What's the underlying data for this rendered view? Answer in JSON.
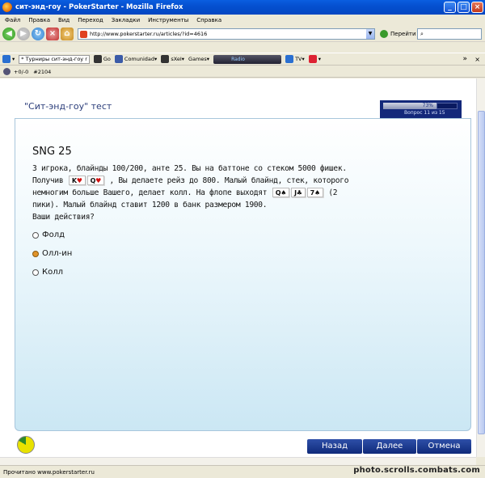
{
  "window": {
    "title": "сит-энд-гоу - PokerStarter - Mozilla Firefox"
  },
  "menu": {
    "items": [
      "Файл",
      "Правка",
      "Вид",
      "Переход",
      "Закладки",
      "Инструменты",
      "Справка"
    ]
  },
  "nav": {
    "url": "http://www.pokerstarter.ru/articles/?id=4616",
    "go_label": "Перейти",
    "search_placeholder": ""
  },
  "bookmarks": {
    "tournaments": "* Турниры сит-энд-гоу r",
    "go": "Go",
    "comunidad": "Comunidad",
    "sxel": "sXeI",
    "games": "Games",
    "radio": "Radio",
    "tv": "TV"
  },
  "subbar": {
    "counter": "+0/-0",
    "id": "#2104"
  },
  "quiz": {
    "title": "\"Сит-энд-гоу\" тест",
    "progress_pct": "73%",
    "progress_value": 0.73,
    "progress_label": "Вопрос 11 из 15",
    "question_title": "SNG 25",
    "text_1": "3 игрока, блайнды 100/200, анте 25. Вы на баттоне со стеком 5000 фишек.",
    "text_2a": "Получив",
    "text_2b": ", Вы делаете рейз до 800. Малый блайнд, стек, которого",
    "text_3a": "немногим больше Вашего, делает колл. На флопе выходят",
    "text_3b": "(2",
    "text_4": "пики). Малый блайнд ставит 1200 в банк размером 1900.",
    "text_5": "Ваши действия?",
    "hole_cards": [
      {
        "rank": "K",
        "suit": "♥"
      },
      {
        "rank": "Q",
        "suit": "♥"
      }
    ],
    "flop_cards": [
      {
        "rank": "Q",
        "suit": "♠"
      },
      {
        "rank": "J",
        "suit": "♣"
      },
      {
        "rank": "7",
        "suit": "♠"
      }
    ],
    "options": [
      {
        "label": "Фолд",
        "selected": false
      },
      {
        "label": "Олл-ин",
        "selected": true
      },
      {
        "label": "Колл",
        "selected": false
      }
    ],
    "buttons": {
      "back": "Назад",
      "next": "Далее",
      "cancel": "Отмена"
    }
  },
  "status": {
    "text": "Прочитано www.pokerstarter.ru",
    "watermark": "photo.scrolls.combats.com"
  },
  "colors": {
    "accent": "#13287a",
    "selected_radio": "#e0932a",
    "heart": "#d01010"
  }
}
